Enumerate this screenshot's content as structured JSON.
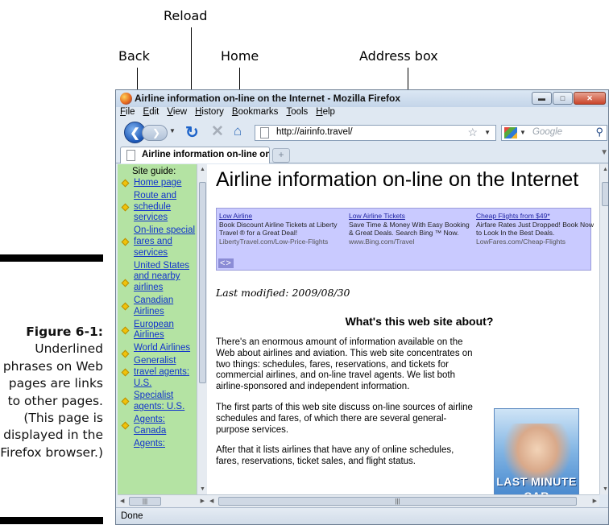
{
  "callouts": {
    "reload": "Reload",
    "back": "Back",
    "home": "Home",
    "address_box": "Address box"
  },
  "caption": {
    "label": "Figure 6-1:",
    "text": "Underlined phrases on Web pages are links to other pages. (This page is displayed in the Firefox browser.)"
  },
  "window": {
    "title": "Airline information on-line on the Internet - Mozilla Firefox",
    "minimize_icon": "minimize-icon",
    "maximize_icon": "maximize-icon",
    "close_icon": "close-icon"
  },
  "menu": [
    "File",
    "Edit",
    "View",
    "History",
    "Bookmarks",
    "Tools",
    "Help"
  ],
  "nav": {
    "back_icon": "back-arrow-icon",
    "forward_icon": "forward-arrow-icon",
    "reload_icon": "reload-icon",
    "stop_icon": "stop-icon",
    "home_icon": "home-icon",
    "url": "http://airinfo.travel/",
    "search_placeholder": "Google"
  },
  "tab": {
    "title": "Airline information on-line on th..."
  },
  "sidebar": {
    "heading": "Site guide:",
    "items": [
      "Home page",
      "Route and schedule services",
      "On-line special fares and services",
      "United States and nearby airlines",
      "Canadian Airlines",
      "European Airlines",
      "World Airlines",
      "Generalist travel agents: U.S.",
      "Specialist agents: U.S.",
      "Agents: Canada",
      "Agents:"
    ]
  },
  "page": {
    "title": "Airline information on-line on the Internet",
    "ads": [
      {
        "title": "Low Airline",
        "desc": "Book Discount Airline Tickets at Liberty Travel ® for a Great Deal!",
        "url": "LibertyTravel.com/Low-Price-Flights"
      },
      {
        "title": "Low Airline Tickets",
        "desc": "Save Time & Money With Easy Booking & Great Deals. Search Bing ™ Now.",
        "url": "www.Bing.com/Travel"
      },
      {
        "title": "Cheap Flights from $49*",
        "desc": "Airfare Rates Just Dropped! Book Now to Look In the Best Deals.",
        "url": "LowFares.com/Cheap-Flights"
      }
    ],
    "ad_nav": "<>",
    "last_modified": "Last modified: 2009/08/30",
    "section_heading": "What's this web site about?",
    "paragraphs": [
      "There's an enormous amount of information available on the Web about airlines and aviation. This web site concentrates on two things: schedules, fares, reservations, and tickets for commercial airlines, and on-line travel agents. We list both airline-sponsored and independent information.",
      "The first parts of this web site discuss on-line sources of airline schedules and fares, of which there are several general-purpose services.",
      "After that it lists airlines that have any of online schedules, fares, reservations, ticket sales, and flight status."
    ],
    "banner": {
      "line1": "LAST MINUTE",
      "line2": "CAR RENTALS"
    }
  },
  "status": {
    "text": "Done"
  }
}
